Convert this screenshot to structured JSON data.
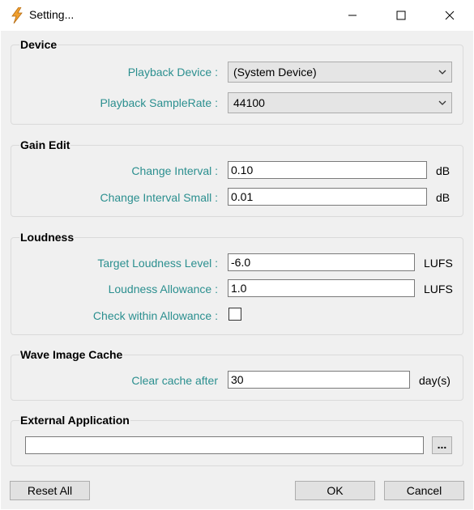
{
  "window": {
    "title": "Setting...",
    "minimize_icon": "minimize-icon",
    "maximize_icon": "maximize-icon",
    "close_icon": "close-icon",
    "app_icon": "lightning-icon"
  },
  "device": {
    "title": "Device",
    "playback_device_label": "Playback Device :",
    "playback_device_value": "(System Device)",
    "samplerate_label": "Playback SampleRate :",
    "samplerate_value": "44100"
  },
  "gain_edit": {
    "title": "Gain Edit",
    "change_interval_label": "Change Interval :",
    "change_interval_value": "0.10",
    "change_interval_unit": "dB",
    "change_interval_small_label": "Change Interval Small :",
    "change_interval_small_value": "0.01",
    "change_interval_small_unit": "dB"
  },
  "loudness": {
    "title": "Loudness",
    "target_label": "Target Loudness Level :",
    "target_value": "-6.0",
    "target_unit": "LUFS",
    "allowance_label": "Loudness Allowance :",
    "allowance_value": "1.0",
    "allowance_unit": "LUFS",
    "check_label": "Check within Allowance :",
    "check_checked": false
  },
  "wave_cache": {
    "title": "Wave Image Cache",
    "clear_label": "Clear cache after",
    "clear_value": "30",
    "clear_unit": "day(s)"
  },
  "external_app": {
    "title": "External Application",
    "path_value": "",
    "browse_label": "..."
  },
  "footer": {
    "reset_label": "Reset All",
    "ok_label": "OK",
    "cancel_label": "Cancel"
  }
}
